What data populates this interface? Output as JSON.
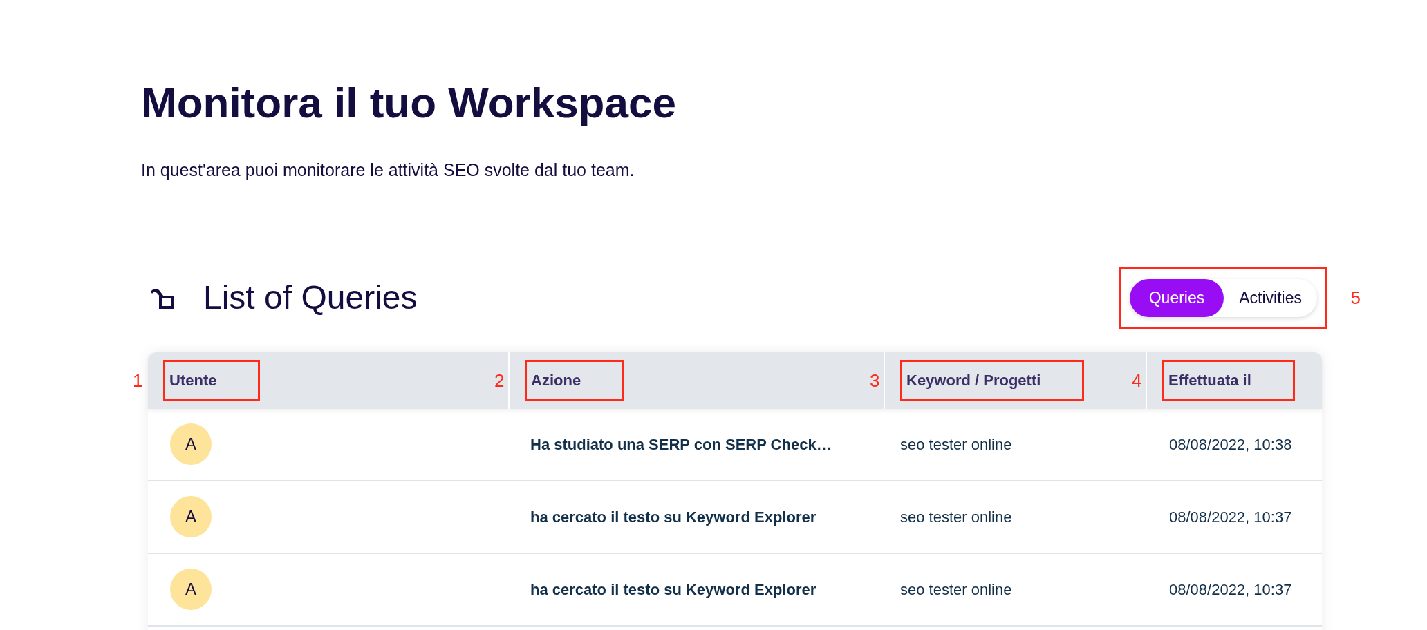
{
  "page": {
    "title": "Monitora il tuo Workspace",
    "description": "In quest'area puoi monitorare le attività SEO svolte dal tuo team."
  },
  "section": {
    "title": "List of Queries"
  },
  "toggle": {
    "annotation": "5",
    "options": [
      {
        "label": "Queries",
        "selected": true
      },
      {
        "label": "Activities",
        "selected": false
      }
    ]
  },
  "table": {
    "columns": [
      {
        "label": "Utente",
        "annotation": "1"
      },
      {
        "label": "Azione",
        "annotation": "2"
      },
      {
        "label": "Keyword / Progetti",
        "annotation": "3"
      },
      {
        "label": "Effettuata il",
        "annotation": "4"
      }
    ],
    "rows": [
      {
        "avatar": "A",
        "action": "Ha studiato una SERP con SERP Check…",
        "keyword": "seo tester online",
        "date": "08/08/2022, 10:38"
      },
      {
        "avatar": "A",
        "action": "ha cercato il testo su Keyword Explorer",
        "keyword": "seo tester online",
        "date": "08/08/2022, 10:37"
      },
      {
        "avatar": "A",
        "action": "ha cercato il testo su Keyword Explorer",
        "keyword": "seo tester online",
        "date": "08/08/2022, 10:37"
      }
    ]
  }
}
